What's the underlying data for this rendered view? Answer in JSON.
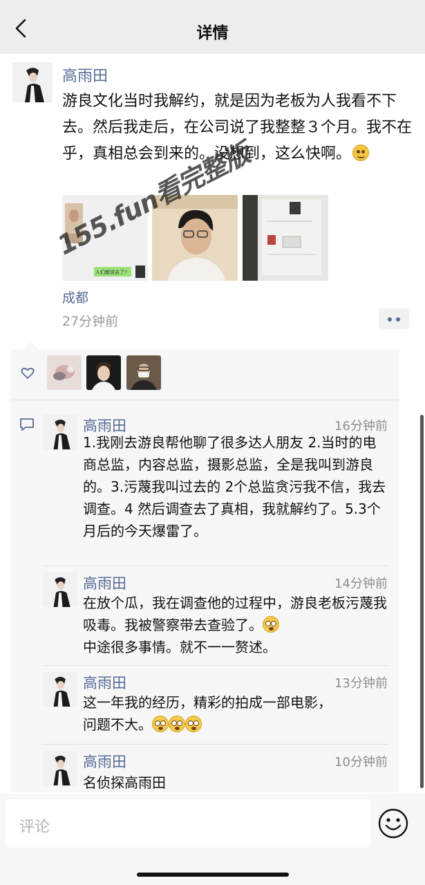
{
  "nav": {
    "title": "详情",
    "back_icon": "chevron-left-icon"
  },
  "post": {
    "author": "高雨田",
    "text": "游良文化当时我解约，就是因为老板为人我看不下去。然后我走后，在公司说了我整整３个月。我不在乎，真相总会到来的。没想到，这么快啊。",
    "image_overlay_text": "人们都说去了?",
    "location": "成都",
    "time": "27分钟前"
  },
  "watermark": {
    "text": "155.fun看完整版"
  },
  "likes": {
    "icon": "heart-outline-icon",
    "avatars": 3
  },
  "comments": [
    {
      "name": "高雨田",
      "time": "16分钟前",
      "text": "1.我刚去游良帮他聊了很多达人朋友 2.当时的电商总监，内容总监，摄影总监，全是我叫到游良的。3.污蔑我叫过去的 2个总监贪污我不信，我去调查。4 然后调查去了真相，我就解约了。5.3个月后的今天爆雷了。"
    },
    {
      "name": "高雨田",
      "time": "14分钟前",
      "text_a": "在放个瓜，我在调查他的过程中，游良老板污蔑我吸毒。我被警察带去查验了。",
      "text_b": "中途很多事情。就不一一赘述。"
    },
    {
      "name": "高雨田",
      "time": "13分钟前",
      "text_a": "这一年我的经历，精彩的拍成一部电影，",
      "text_b": "问题不大。"
    },
    {
      "name": "高雨田",
      "time": "10分钟前",
      "text": "名侦探高雨田"
    }
  ],
  "input": {
    "placeholder": "评论",
    "emoji_icon": "smiley-icon"
  }
}
